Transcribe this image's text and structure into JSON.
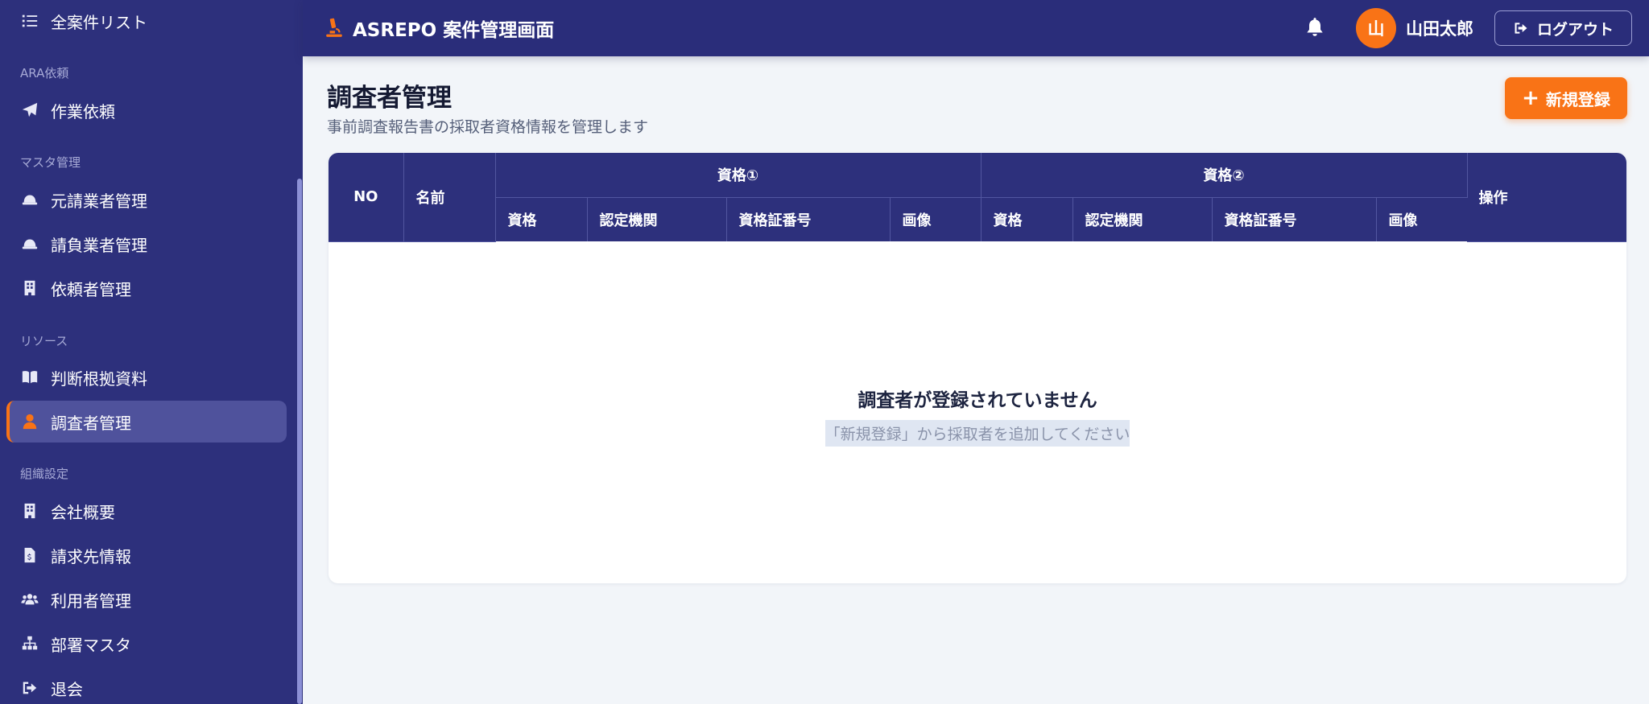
{
  "app": {
    "title": "ASREPO 案件管理画面",
    "user_initial": "山",
    "user_name": "山田太郎",
    "logout_label": "ログアウト",
    "accent_color": "#f97316",
    "sidebar_color": "#2d307c"
  },
  "sidebar": {
    "items": [
      {
        "label": "全案件リスト",
        "icon": "list-icon"
      },
      {
        "label": "作業依頼",
        "icon": "paper-plane-icon"
      },
      {
        "label": "元請業者管理",
        "icon": "hard-hat-icon"
      },
      {
        "label": "請負業者管理",
        "icon": "hard-hat-icon"
      },
      {
        "label": "依頼者管理",
        "icon": "building-icon"
      },
      {
        "label": "判断根拠資料",
        "icon": "book-icon"
      },
      {
        "label": "調査者管理",
        "icon": "user-tie-icon",
        "active": true
      },
      {
        "label": "会社概要",
        "icon": "building-icon"
      },
      {
        "label": "請求先情報",
        "icon": "invoice-icon"
      },
      {
        "label": "利用者管理",
        "icon": "users-icon"
      },
      {
        "label": "部署マスタ",
        "icon": "sitemap-icon"
      },
      {
        "label": "退会",
        "icon": "sign-out-icon"
      }
    ],
    "sections": [
      "ARA依頼",
      "マスタ管理",
      "リソース",
      "組織設定"
    ]
  },
  "main": {
    "title": "調査者管理",
    "description": "事前調査報告書の採取者資格情報を管理します",
    "new_button_label": "新規登録"
  },
  "table": {
    "col_no": "NO",
    "col_name": "名前",
    "group1": "資格①",
    "group2": "資格②",
    "col_actions": "操作",
    "sub_cols": [
      "資格",
      "認定機関",
      "資格証番号",
      "画像"
    ]
  },
  "empty_state": {
    "title": "調査者が登録されていません",
    "subtitle": "「新規登録」から採取者を追加してください"
  }
}
